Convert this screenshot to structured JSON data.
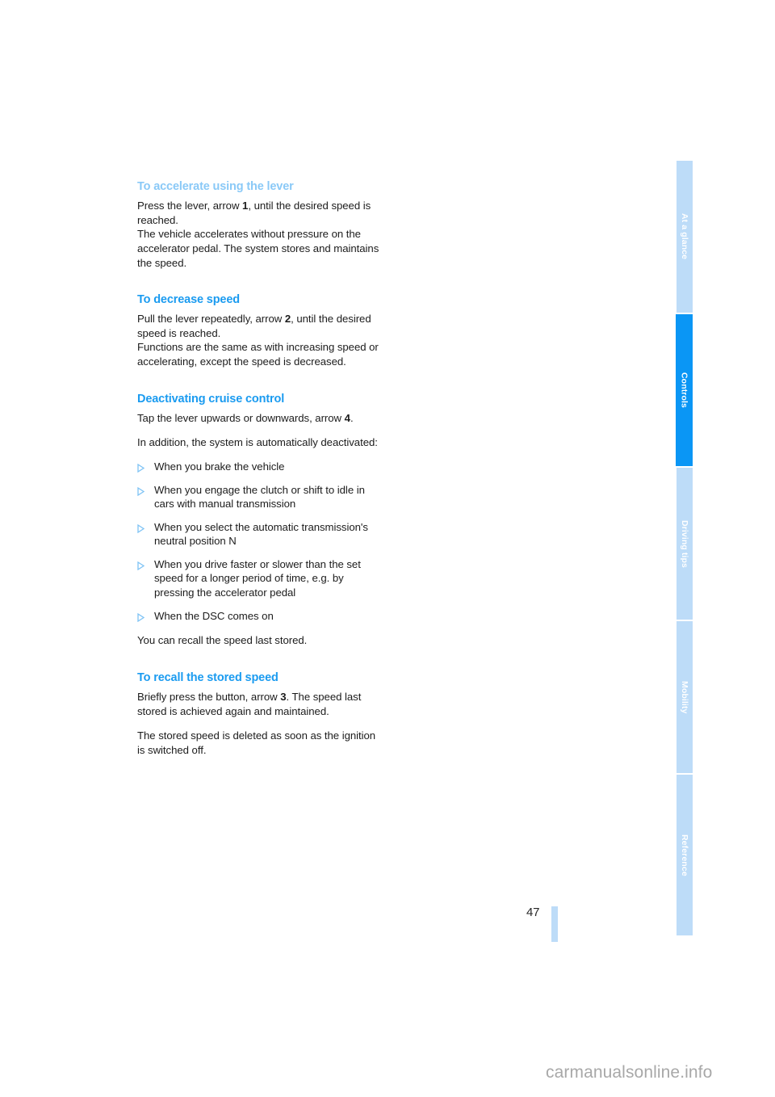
{
  "document": {
    "page_number": "47",
    "watermark": "carmanualsonline.info"
  },
  "sidebar": {
    "tabs": [
      {
        "label": "At a glance",
        "active": false
      },
      {
        "label": "Controls",
        "active": true
      },
      {
        "label": "Driving tips",
        "active": false
      },
      {
        "label": "Mobility",
        "active": false
      },
      {
        "label": "Reference",
        "active": false
      }
    ]
  },
  "content": {
    "sections": [
      {
        "heading": "To accelerate using the lever",
        "paragraphs": [
          "Press the lever, arrow 1, until the desired speed is reached.",
          "The vehicle accelerates without pressure on the accelerator pedal. The system stores and maintains the speed."
        ]
      },
      {
        "heading": "To decrease speed",
        "paragraphs": [
          "Pull the lever repeatedly, arrow 2, until the desired speed is reached.",
          "Functions are the same as with increasing speed or accelerating, except the speed is decreased."
        ]
      },
      {
        "heading": "Deactivating cruise control",
        "paragraphs": [
          "Tap the lever upwards or downwards, arrow 4.",
          "In addition, the system is automatically deactivated:"
        ],
        "bullets": [
          "When you brake the vehicle",
          "When you engage the clutch or shift to idle in cars with manual transmission",
          "When you select the automatic transmission's neutral position N",
          "When you drive faster or slower than the set speed for a longer period of time, e.g. by pressing the accelerator pedal",
          "When the DSC comes on"
        ],
        "closing": "You can recall the speed last stored."
      },
      {
        "heading": "To recall the stored speed",
        "paragraphs": [
          "Briefly press the button, arrow 3. The speed last stored is achieved again and maintained.",
          "The stored speed is deleted as soon as the ignition is switched off."
        ]
      }
    ],
    "arrow_refs": {
      "accelerate": "1",
      "decrease": "2",
      "recall": "3",
      "deactivate": "4"
    }
  },
  "colors": {
    "heading_blue": "#1a9bf0",
    "heading_blue_faded": "#8ac9f7",
    "tab_active": "#0a96f5",
    "tab_inactive": "#bddcf8",
    "body_text": "#1c1c1c",
    "watermark": "#a8a8a8"
  }
}
